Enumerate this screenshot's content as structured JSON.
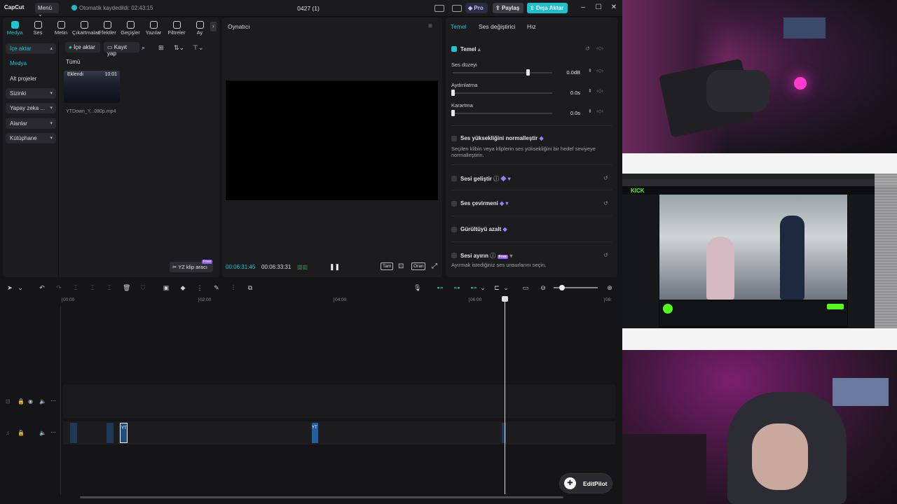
{
  "titlebar": {
    "logo": "CapCut",
    "menu_label": "Menü",
    "save_status": "Otomatik kaydedildi: 02:43:15",
    "project_title": "0427 (1)",
    "pro_label": "Pro",
    "share_label": "Paylaş",
    "export_label": "Dışa Aktar"
  },
  "toolbar_tabs": [
    {
      "label": "Medya",
      "icon": "media-icon"
    },
    {
      "label": "Ses",
      "icon": "audio-icon"
    },
    {
      "label": "Metin",
      "icon": "text-icon"
    },
    {
      "label": "Çıkartmalar",
      "icon": "sticker-icon"
    },
    {
      "label": "Efektler",
      "icon": "effects-icon"
    },
    {
      "label": "Geçişler",
      "icon": "transitions-icon"
    },
    {
      "label": "Yazılar",
      "icon": "captions-icon"
    },
    {
      "label": "Filtreler",
      "icon": "filters-icon"
    },
    {
      "label": "Ay",
      "icon": "adjust-icon"
    }
  ],
  "sidebar": {
    "items": [
      {
        "label": "İçe aktar",
        "chevron": "▴"
      },
      {
        "label": "Medya",
        "chevron": ""
      },
      {
        "label": "Alt projeler",
        "chevron": ""
      },
      {
        "label": "Sizinki",
        "chevron": "▾"
      },
      {
        "label": "Yapay zeka ...",
        "chevron": "▾"
      },
      {
        "label": "Alanlar",
        "chevron": "▾"
      },
      {
        "label": "Kütüphane",
        "chevron": "▾"
      }
    ]
  },
  "media": {
    "import_label": "İçe aktar",
    "record_label": "Kayıt yap",
    "filter_all": "Tümü",
    "clip_added": "Eklendi",
    "clip_duration": "10:01",
    "clip_name": "YTDown_Y...080p.mp4",
    "ai_clip_label": "YZ klip aracı",
    "free_badge": "Free"
  },
  "player": {
    "title": "Oynatıcı",
    "current_time": "00:06:31:45",
    "total_time": "00:06:33:31",
    "full_label": "Tam",
    "ratio_label": "Oran"
  },
  "props": {
    "tabs": [
      "Temel",
      "Ses değiştirici",
      "Hız"
    ],
    "section_basic": "Temel",
    "volume_label": "Ses düzeyi",
    "volume_value": "0.0dB",
    "volume_level": 0.75,
    "fadein_label": "Aydınlatma",
    "fadein_value": "0.0s",
    "fadeout_label": "Karartma",
    "fadeout_value": "0.0s",
    "normalize_label": "Ses yüksekliğini normalleştir",
    "normalize_desc": "Seçilen klibin veya kliplerin ses yüksekliğini bir hedef seviyeye normalleştirin.",
    "enhance_label": "Sesi geliştir",
    "voice_changer_label": "Ses çevirmeni",
    "noise_label": "Gürültüyü azalt",
    "separate_label": "Sesi ayırın",
    "separate_badge": "Free",
    "separate_desc": "Ayırmak istediğiniz ses unsurlarını seçin."
  },
  "timeline": {
    "ticks": [
      "00:00",
      "02:00",
      "04:00",
      "06:00",
      "08:"
    ],
    "playhead_label": "",
    "clip_tag_1": "YT",
    "clip_tag_2": "YT"
  },
  "editpilot": {
    "label": "EditPilot"
  },
  "colors": {
    "accent": "#1fc6d0",
    "pro": "#8c5cf6",
    "clip": "#1f4e82"
  }
}
